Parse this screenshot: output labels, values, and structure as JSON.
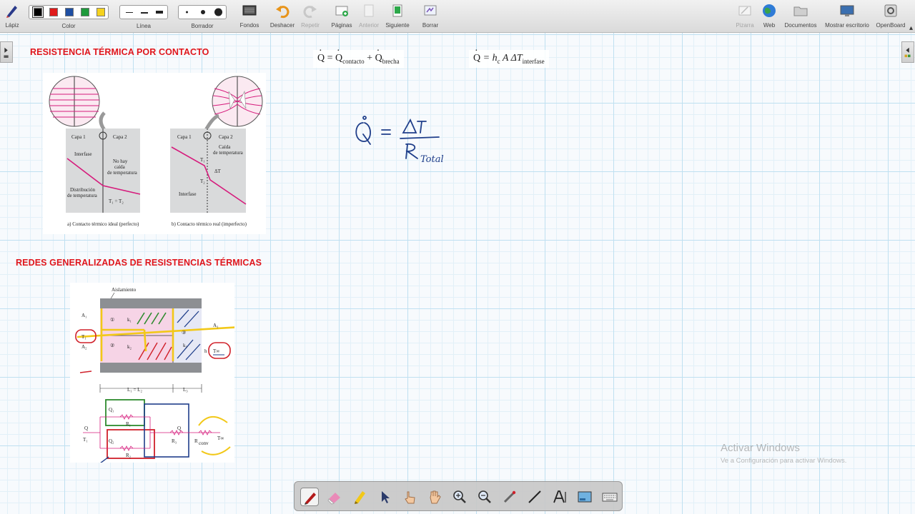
{
  "toolbar": {
    "lapiz": "Lápiz",
    "color": "Color",
    "linea": "Línea",
    "borrador": "Borrador",
    "fondos": "Fondos",
    "deshacer": "Deshacer",
    "repetir": "Repetir",
    "paginas": "Páginas",
    "anterior": "Anterior",
    "siguiente": "Siguiente",
    "borrar": "Borrar",
    "pizarra": "Pizarra",
    "web": "Web",
    "documentos": "Documentos",
    "mostrar_escritorio": "Mostrar escritorio",
    "openboard": "OpenBoard",
    "colors": [
      "#000000",
      "#e01b1b",
      "#1f4fa3",
      "#1f9a3c",
      "#f5d21e"
    ]
  },
  "board": {
    "heading1": "RESISTENCIA TÉRMICA POR CONTACTO",
    "heading2": "REDES GENERALIZADAS DE RESISTENCIAS TÉRMICAS",
    "formula1": {
      "lhs": "Q",
      "eq": " = ",
      "t1": "Q",
      "t1_sub": "contacto",
      "plus": " + ",
      "t2": "Q",
      "t2_sub": "brecha"
    },
    "formula2": {
      "lhs": "Q",
      "rhs": " = h",
      "rhs_sub": "c",
      "rhs_rest": " A ΔT",
      "rhs_sub2": "interfase"
    },
    "handwriting": {
      "lhs": "Q",
      "eq": "=",
      "num": "ΔT",
      "den": "R",
      "den_sub": "Total"
    },
    "fig1": {
      "capa1": "Capa 1",
      "capa2": "Capa 2",
      "interfase": "Interfase",
      "no_hay": "No hay",
      "caida": "caída",
      "de_temperatura": "de temperatura",
      "distribucion": "Distribución",
      "t_eq": "T₁ = T₂",
      "cap_a": "a) Contacto térmico ideal (perfecto)",
      "cap_b": "b) Contacto térmico real (imperfecto)",
      "t1": "T₁",
      "t2": "T₂",
      "delta_t": "ΔT",
      "caida_b": "Caída"
    },
    "fig2": {
      "aislamiento": "Aislamiento",
      "a1": "A₁",
      "a2": "A₂",
      "a3": "A₃",
      "t1": "T₁",
      "tinf": "T∞",
      "h": "h",
      "k1": "k₁",
      "k2": "k₂",
      "k3": "k₃",
      "n1": "①",
      "n2": "②",
      "n3": "③",
      "l12": "L₁ = L₂",
      "l3": "L₃",
      "q": "Q",
      "q1": "Q₁",
      "q2": "Q₂",
      "r1": "R₁",
      "r2": "R₂",
      "r3": "R₃",
      "rconv": "R",
      "rconv_sub": "conv"
    },
    "watermark_title": "Activar Windows",
    "watermark_sub": "Ve a Configuración para activar Windows."
  }
}
